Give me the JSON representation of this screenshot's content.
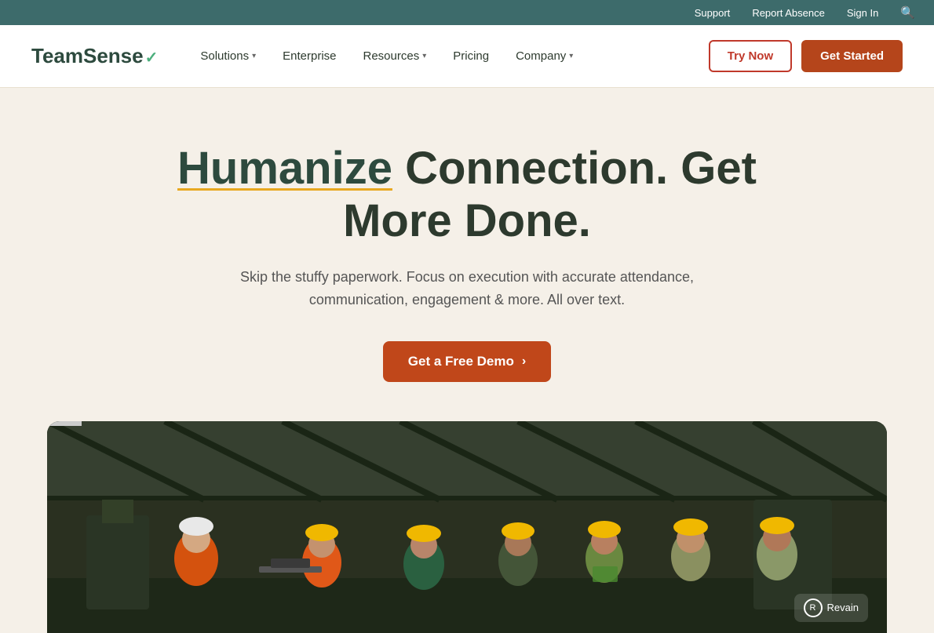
{
  "topbar": {
    "support_label": "Support",
    "report_absence_label": "Report Absence",
    "sign_in_label": "Sign In",
    "search_icon": "🔍"
  },
  "nav": {
    "logo_team": "Team",
    "logo_sense": "Sense",
    "logo_check": "✓",
    "solutions_label": "Solutions",
    "enterprise_label": "Enterprise",
    "resources_label": "Resources",
    "pricing_label": "Pricing",
    "company_label": "Company",
    "try_now_label": "Try Now",
    "get_started_label": "Get Started"
  },
  "hero": {
    "headline_humanize": "Humanize",
    "headline_rest": " Connection. Get More Done.",
    "subtext": "Skip the stuffy paperwork. Focus on execution with accurate attendance, communication, engagement & more. All over text.",
    "cta_label": "Get a Free Demo",
    "cta_arrow": "›"
  },
  "watermark": {
    "brand": "Revain"
  }
}
